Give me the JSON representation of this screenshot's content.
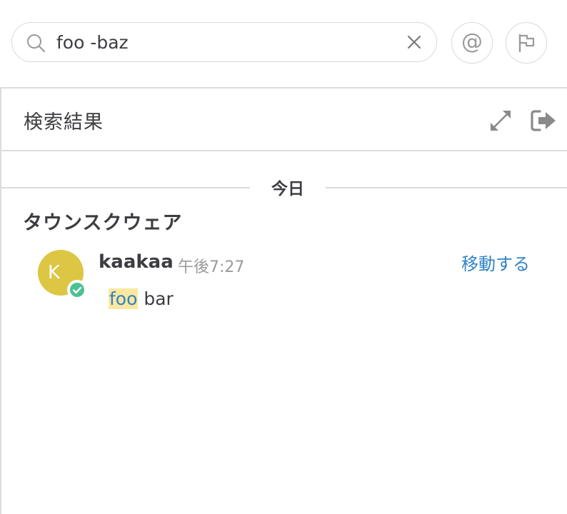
{
  "search": {
    "value": "foo -baz",
    "clear_icon": "close-icon",
    "search_icon": "search-icon"
  },
  "toolbar": {
    "mention_glyph": "@",
    "mention_icon": "at-icon",
    "flag_icon": "flag-icon"
  },
  "panel": {
    "title": "検索結果",
    "expand_icon": "expand-icon",
    "exit_icon": "exit-icon"
  },
  "results": {
    "date_label": "今日",
    "channel": "タウンスクウェア",
    "post": {
      "avatar_letter": "K",
      "avatar_color": "#dcc644",
      "status_color": "#4cc193",
      "username": "kaakaa",
      "time": "午後7:27",
      "jump_label": "移動する",
      "message_highlight": "foo",
      "message_rest": " bar"
    }
  },
  "colors": {
    "link": "#2f82c6",
    "highlight_bg": "#fbe8a0",
    "border": "#dcdcdc",
    "text": "#3d3c40",
    "muted": "#9a9a9a"
  }
}
